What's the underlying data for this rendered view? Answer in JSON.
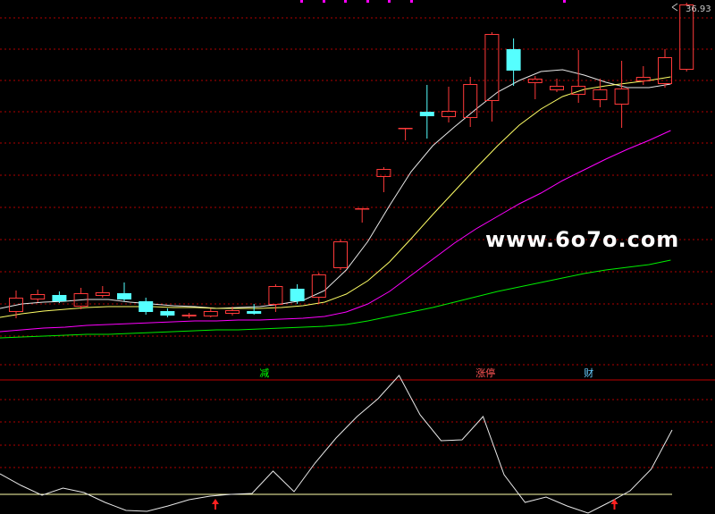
{
  "chart_data": {
    "type": "candlestick",
    "price_label": "36.93",
    "watermark": "www.6o7o.com",
    "annotations": [
      {
        "text": "减",
        "candle": 11,
        "color": "#00ff00"
      },
      {
        "text": "涨停",
        "candle": 21,
        "color": "#ff5555"
      },
      {
        "text": "财",
        "candle": 26,
        "color": "#66ccff"
      }
    ],
    "candles": [
      {
        "o": 333,
        "c": 349,
        "h": 325,
        "l": 356,
        "up": true
      },
      {
        "o": 329,
        "c": 335,
        "h": 324,
        "l": 338,
        "up": true
      },
      {
        "o": 330,
        "c": 337,
        "h": 326,
        "l": 339,
        "up": false
      },
      {
        "o": 328,
        "c": 343,
        "h": 322,
        "l": 346,
        "up": true
      },
      {
        "o": 327,
        "c": 331,
        "h": 320,
        "l": 333,
        "up": true
      },
      {
        "o": 328,
        "c": 335,
        "h": 316,
        "l": 337,
        "up": false
      },
      {
        "o": 337,
        "c": 349,
        "h": 333,
        "l": 352,
        "up": false
      },
      {
        "o": 348,
        "c": 353,
        "h": 345,
        "l": 355,
        "up": false
      },
      {
        "o": 352,
        "c": 354,
        "h": 350,
        "l": 356,
        "up": true
      },
      {
        "o": 348,
        "c": 354,
        "h": 345,
        "l": 355,
        "up": true
      },
      {
        "o": 347,
        "c": 351,
        "h": 343,
        "l": 353,
        "up": true
      },
      {
        "o": 348,
        "c": 351,
        "h": 340,
        "l": 352,
        "up": false
      },
      {
        "o": 320,
        "c": 341,
        "h": 318,
        "l": 349,
        "up": true
      },
      {
        "o": 323,
        "c": 337,
        "h": 318,
        "l": 340,
        "up": false
      },
      {
        "o": 307,
        "c": 333,
        "h": 305,
        "l": 340,
        "up": true
      },
      {
        "o": 270,
        "c": 300,
        "h": 268,
        "l": 302,
        "up": true
      },
      {
        "o": 233,
        "c": 233,
        "h": 233,
        "l": 249,
        "up": true
      },
      {
        "o": 189,
        "c": 198,
        "h": 187,
        "l": 215,
        "up": true
      },
      {
        "o": 143,
        "c": 143,
        "h": 143,
        "l": 157,
        "up": true
      },
      {
        "o": 125,
        "c": 130,
        "h": 95,
        "l": 155,
        "up": false
      },
      {
        "o": 124,
        "c": 131,
        "h": 97,
        "l": 137,
        "up": true
      },
      {
        "o": 94,
        "c": 132,
        "h": 86,
        "l": 142,
        "up": true
      },
      {
        "o": 38,
        "c": 113,
        "h": 36,
        "l": 136,
        "up": true
      },
      {
        "o": 55,
        "c": 79,
        "h": 43,
        "l": 96,
        "up": false
      },
      {
        "o": 88,
        "c": 93,
        "h": 85,
        "l": 111,
        "up": true
      },
      {
        "o": 96,
        "c": 101,
        "h": 88,
        "l": 103,
        "up": true
      },
      {
        "o": 96,
        "c": 106,
        "h": 56,
        "l": 115,
        "up": true
      },
      {
        "o": 100,
        "c": 112,
        "h": 88,
        "l": 120,
        "up": true
      },
      {
        "o": 99,
        "c": 117,
        "h": 68,
        "l": 143,
        "up": true
      },
      {
        "o": 86,
        "c": 91,
        "h": 74,
        "l": 95,
        "up": true
      },
      {
        "o": 64,
        "c": 94,
        "h": 55,
        "l": 98,
        "up": true
      },
      {
        "o": 5,
        "c": 78,
        "h": 3,
        "l": 80,
        "up": true
      }
    ],
    "ma": [
      {
        "color": "#e8e8e8",
        "values": [
          345,
          340,
          338,
          337,
          335,
          335,
          338,
          340,
          342,
          343,
          345,
          344,
          343,
          340,
          336,
          325,
          302,
          270,
          230,
          192,
          163,
          142,
          122,
          103,
          90,
          80,
          78,
          84,
          92,
          98,
          98,
          94
        ]
      },
      {
        "color": "#ffff66",
        "values": [
          355,
          351,
          348,
          346,
          344,
          343,
          343,
          343,
          344,
          344,
          345,
          345,
          345,
          344,
          342,
          338,
          329,
          314,
          293,
          267,
          240,
          214,
          188,
          163,
          140,
          122,
          108,
          100,
          96,
          93,
          90,
          86
        ]
      },
      {
        "color": "#ff00ff",
        "values": [
          371,
          369,
          367,
          366,
          364,
          363,
          362,
          361,
          360,
          359,
          359,
          358,
          358,
          357,
          356,
          354,
          349,
          340,
          326,
          308,
          290,
          272,
          256,
          242,
          228,
          216,
          202,
          190,
          178,
          167,
          157,
          146
        ]
      },
      {
        "color": "#00ee00",
        "values": [
          378,
          377,
          376,
          375,
          374,
          374,
          373,
          372,
          371,
          370,
          369,
          369,
          368,
          367,
          366,
          365,
          363,
          359,
          354,
          349,
          344,
          338,
          332,
          326,
          321,
          316,
          311,
          306,
          302,
          299,
          296,
          291
        ]
      }
    ],
    "indicator": {
      "color": "#e8e8e8",
      "baseline_color": "#ffffaa",
      "values": [
        530,
        543,
        554,
        546,
        551,
        562,
        571,
        572,
        566,
        559,
        555,
        553,
        552,
        527,
        550,
        518,
        490,
        466,
        446,
        420,
        464,
        493,
        492,
        466,
        531,
        562,
        556,
        566,
        574,
        562,
        549,
        525,
        481
      ],
      "arrows": [
        10,
        29
      ]
    }
  }
}
